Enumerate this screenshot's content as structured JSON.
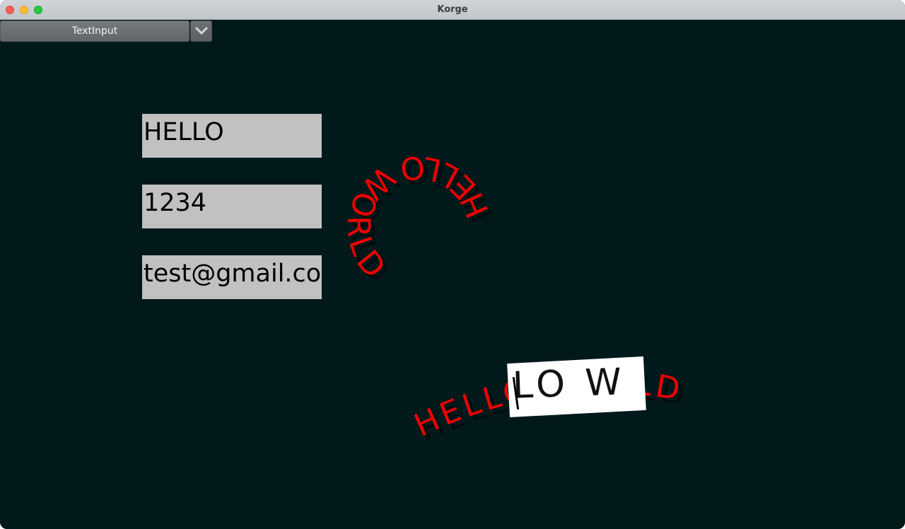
{
  "window": {
    "title": "Korge"
  },
  "toolbar": {
    "dropdown_selected": "TextInput",
    "dropdown_icon": "chevron-down-icon"
  },
  "inputs": [
    {
      "value": "HELLO"
    },
    {
      "value": "1234"
    },
    {
      "value": "test@gmail.com"
    }
  ],
  "curved_text": {
    "circle_text": "HELLO WORLD",
    "arc_text": "HELLO WORLD",
    "selected_text": "LO W"
  },
  "colors": {
    "background": "#01191b",
    "input_background": "#c1c1c1",
    "curved_text": "#ee0000",
    "selection_highlight": "#ffffff",
    "titlebar": "#c9cdd0",
    "close": "#fe5f57",
    "minimize": "#febc2e",
    "zoom": "#28c840"
  }
}
